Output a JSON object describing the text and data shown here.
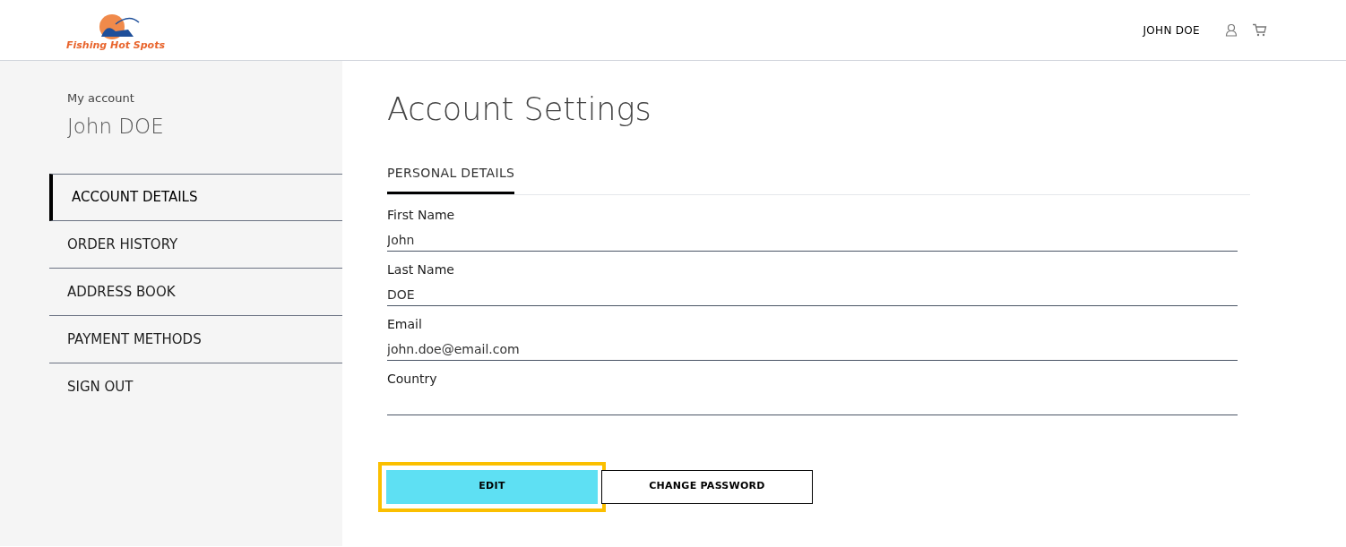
{
  "header": {
    "logo_text": "Fishing Hot Spots",
    "user_name": "JOHN DOE"
  },
  "sidebar": {
    "caption": "My account",
    "name": "John DOE",
    "items": [
      {
        "label": "ACCOUNT DETAILS",
        "selected": true
      },
      {
        "label": "ORDER HISTORY",
        "selected": false
      },
      {
        "label": "ADDRESS BOOK",
        "selected": false
      },
      {
        "label": "PAYMENT METHODS",
        "selected": false
      },
      {
        "label": "SIGN OUT",
        "selected": false
      }
    ]
  },
  "main": {
    "title": "Account Settings",
    "tabs": [
      {
        "label": "PERSONAL DETAILS",
        "selected": true
      }
    ],
    "fields": [
      {
        "label": "First Name",
        "value": "John"
      },
      {
        "label": "Last Name",
        "value": "DOE"
      },
      {
        "label": "Email",
        "value": "john.doe@email.com"
      },
      {
        "label": "Country"
      }
    ],
    "buttons": [
      {
        "label": "EDIT",
        "kind": "primary",
        "focused": true
      },
      {
        "label": "CHANGE PASSWORD",
        "kind": "outline",
        "focused": false
      }
    ]
  }
}
